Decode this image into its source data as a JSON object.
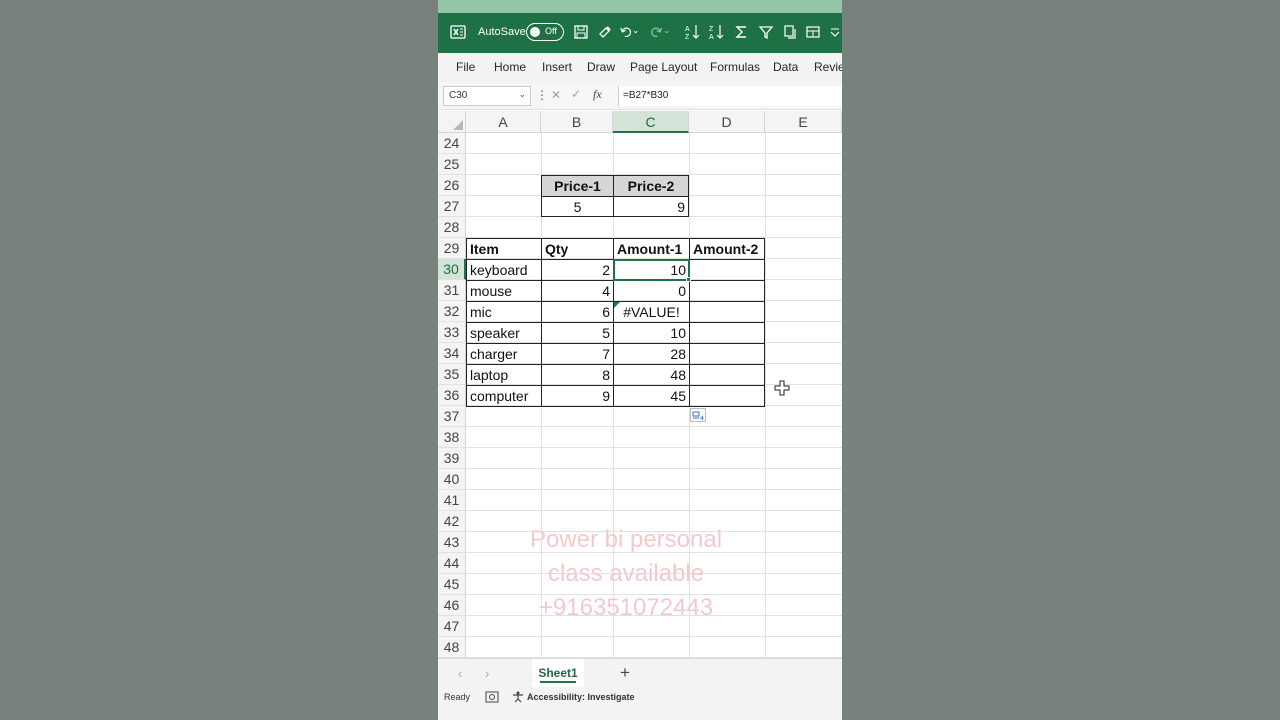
{
  "titlebar": {
    "autosave_label": "AutoSave",
    "autosave_state": "Off",
    "icons": [
      "excel-logo-icon",
      "save-icon",
      "format-painter-icon",
      "undo-icon",
      "redo-icon",
      "sort-ascending-icon",
      "sort-descending-icon",
      "autosum-icon",
      "filter-icon",
      "copy-icon",
      "form-icon",
      "customize-icon"
    ]
  },
  "ribbon": {
    "tabs": [
      "File",
      "Home",
      "Insert",
      "Draw",
      "Page Layout",
      "Formulas",
      "Data",
      "Revie"
    ]
  },
  "formula_bar": {
    "name_box": "C30",
    "formula": "=B27*B30",
    "fx_label": "fx"
  },
  "grid": {
    "columns": [
      "A",
      "B",
      "C",
      "D",
      "E"
    ],
    "rows": [
      "24",
      "25",
      "26",
      "27",
      "28",
      "29",
      "30",
      "31",
      "32",
      "33",
      "34",
      "35",
      "36",
      "37",
      "38",
      "39",
      "40",
      "41",
      "42",
      "43",
      "44",
      "45",
      "46",
      "47",
      "48"
    ],
    "price_headers": [
      "Price-1",
      "Price-2"
    ],
    "price_values": [
      "5",
      "9"
    ],
    "table_headers": [
      "Item",
      "Qty",
      "Amount-1",
      "Amount-2"
    ],
    "table_rows": [
      {
        "item": "keyboard",
        "qty": "2",
        "amount1": "10",
        "amount2": ""
      },
      {
        "item": "mouse",
        "qty": "4",
        "amount1": "0",
        "amount2": ""
      },
      {
        "item": "mic",
        "qty": "6",
        "amount1": "#VALUE!",
        "amount2": ""
      },
      {
        "item": "speaker",
        "qty": "5",
        "amount1": "10",
        "amount2": ""
      },
      {
        "item": "charger",
        "qty": "7",
        "amount1": "28",
        "amount2": ""
      },
      {
        "item": "laptop",
        "qty": "8",
        "amount1": "48",
        "amount2": ""
      },
      {
        "item": "computer",
        "qty": "9",
        "amount1": "45",
        "amount2": ""
      }
    ]
  },
  "watermark": {
    "line1": "Power bi personal",
    "line2": "class available",
    "line3": "+916351072443"
  },
  "sheet_tabs": {
    "active": "Sheet1",
    "add_label": "+"
  },
  "status_bar": {
    "ready": "Ready",
    "accessibility": "Accessibility: Investigate"
  },
  "colors": {
    "excel_green": "#1e7145",
    "accent": "#217346",
    "watermark": "#f4c9cc"
  }
}
